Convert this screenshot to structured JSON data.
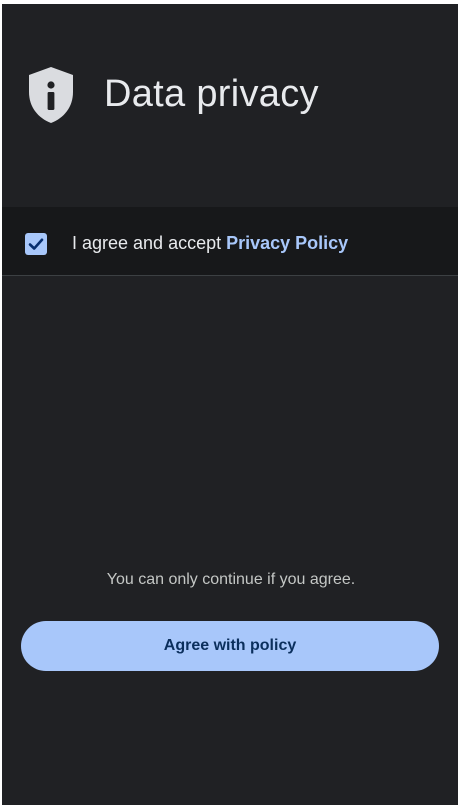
{
  "header": {
    "icon": "shield-info-icon",
    "title": "Data privacy"
  },
  "consent": {
    "checked": true,
    "label_prefix": "I agree and accept ",
    "link_text": "Privacy Policy"
  },
  "footer": {
    "hint": "You can only continue if you agree.",
    "button_label": "Agree with policy"
  },
  "colors": {
    "background": "#202124",
    "consent_row": "#17181a",
    "accent": "#a8c7fa",
    "button_text": "#0b2f5c",
    "text_primary": "#e8eaed",
    "text_secondary": "#c4c7c5"
  }
}
